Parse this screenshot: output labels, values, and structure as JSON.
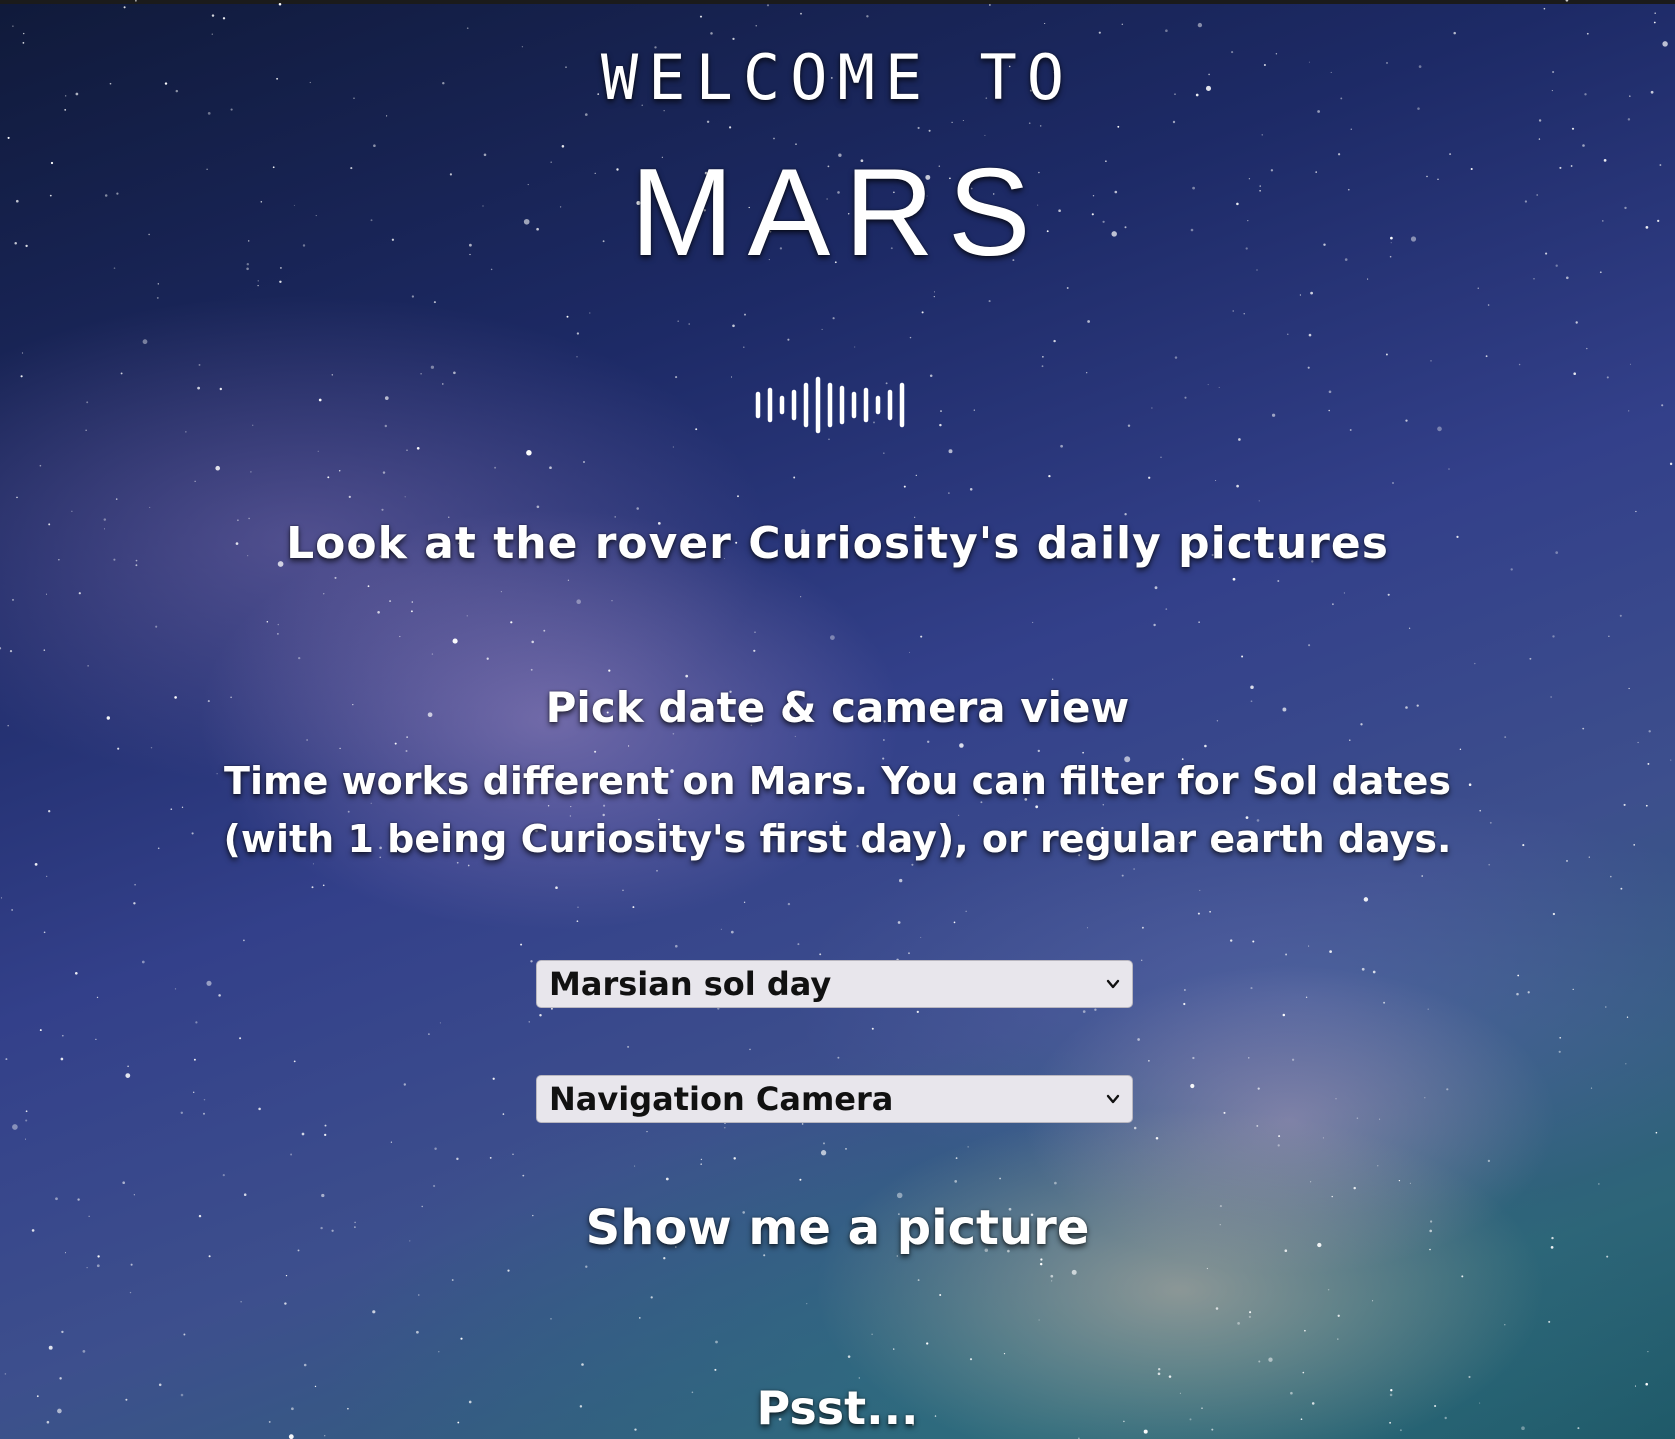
{
  "hero": {
    "welcome_text": "WELCOME TO",
    "planet_name": "MARS",
    "logo_icon": "sound-wave-icon"
  },
  "intro": {
    "headline": "Look at the rover Curiosity's daily pictures"
  },
  "filters": {
    "title": "Pick date & camera view",
    "description": "Time works different on Mars. You can filter for Sol dates (with 1 being Curiosity's first day), or regular earth days.",
    "date_type_select": {
      "selected": "Marsian sol day",
      "icon": "chevron-down-icon"
    },
    "camera_select": {
      "selected": "Navigation Camera",
      "icon": "chevron-down-icon"
    }
  },
  "actions": {
    "show_picture_label": "Show me a picture"
  },
  "footer": {
    "teaser": "Psst..."
  },
  "colors": {
    "text": "#ffffff",
    "select_bg": "#e8e6ec",
    "select_text": "#111111",
    "sky_dark": "#101a3a",
    "sky_mid": "#33408a",
    "nebula_teal": "#2d6578"
  }
}
